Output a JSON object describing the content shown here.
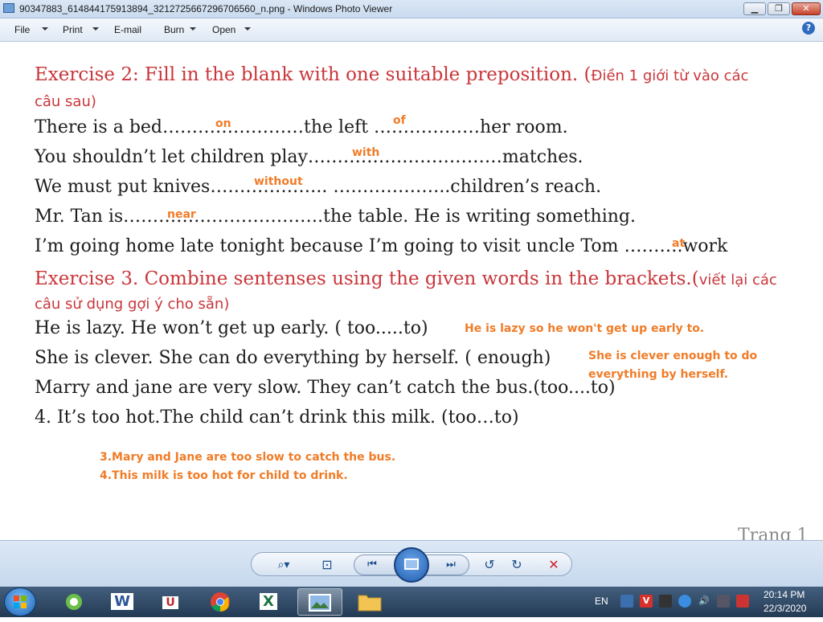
{
  "window": {
    "title": "90347883_614844175913894_3212725667296706560_n.png - Windows Photo Viewer",
    "minimize_glyph": "▁",
    "maximize_glyph": "❐",
    "close_glyph": "✕"
  },
  "menu": {
    "file": "File",
    "print": "Print",
    "email": "E-mail",
    "burn": "Burn",
    "open": "Open",
    "help_glyph": "?"
  },
  "document": {
    "ex2_heading": "Exercise 2: Fill in the blank with one suitable preposition. (",
    "ex2_heading_viet": "Điền 1 giới từ vào các",
    "ex2_heading_cont": "câu sau)",
    "ex2_lines": [
      "There is a bed……………………the left  ………………her room.",
      "You shouldn’t let  children play……………………………matches.",
      "We must put knives………………..    ………………..children’s reach.",
      "Mr. Tan is…………………………….the table. He is writing something.",
      "I’m going home late tonight because I’m going to visit uncle Tom ……….work"
    ],
    "ex3_heading": "Exercise 3.  Combine sentenses using the given  words in the brackets.(",
    "ex3_heading_viet": "viết lại các",
    "ex3_heading_cont": "câu sử dụng  gợi ý cho sẵn)",
    "ex3_lines": [
      "He is lazy. He won’t get up early. ( too.....to)",
      "She is clever. She can do everything by herself. ( enough)",
      "Marry and jane are very slow. They can’t catch the bus.(too....to)",
      "4. It’s too hot.The child can’t drink this milk. (too…to)"
    ],
    "page_label": "Trang 1"
  },
  "answers": {
    "a1": "on",
    "a2": "of",
    "a3": "with",
    "a4": "without",
    "a5": "near",
    "a6": "at",
    "s1": "He is lazy so he won't get up early to.",
    "s2_line1": "She is clever enough to do",
    "s2_line2": "everything by herself.",
    "s3": "3.Mary and Jane are too slow to catch the bus.",
    "s4": "4.This milk is too hot for child to drink."
  },
  "viewer_controls": {
    "zoom_glyph": "⌕▾",
    "actual_size_glyph": "⊡",
    "prev_glyph": "⏮",
    "next_glyph": "⏭",
    "rotate_ccw_glyph": "↺",
    "rotate_cw_glyph": "↻",
    "delete_glyph": "✕"
  },
  "taskbar": {
    "word_glyph": "W",
    "unikey_glyph": "U",
    "excel_glyph": "X",
    "lang": "EN",
    "time": "20:14 PM",
    "date": "22/3/2020"
  },
  "colors": {
    "exercise_heading": "#c9363b",
    "answer_text": "#f07c28"
  }
}
